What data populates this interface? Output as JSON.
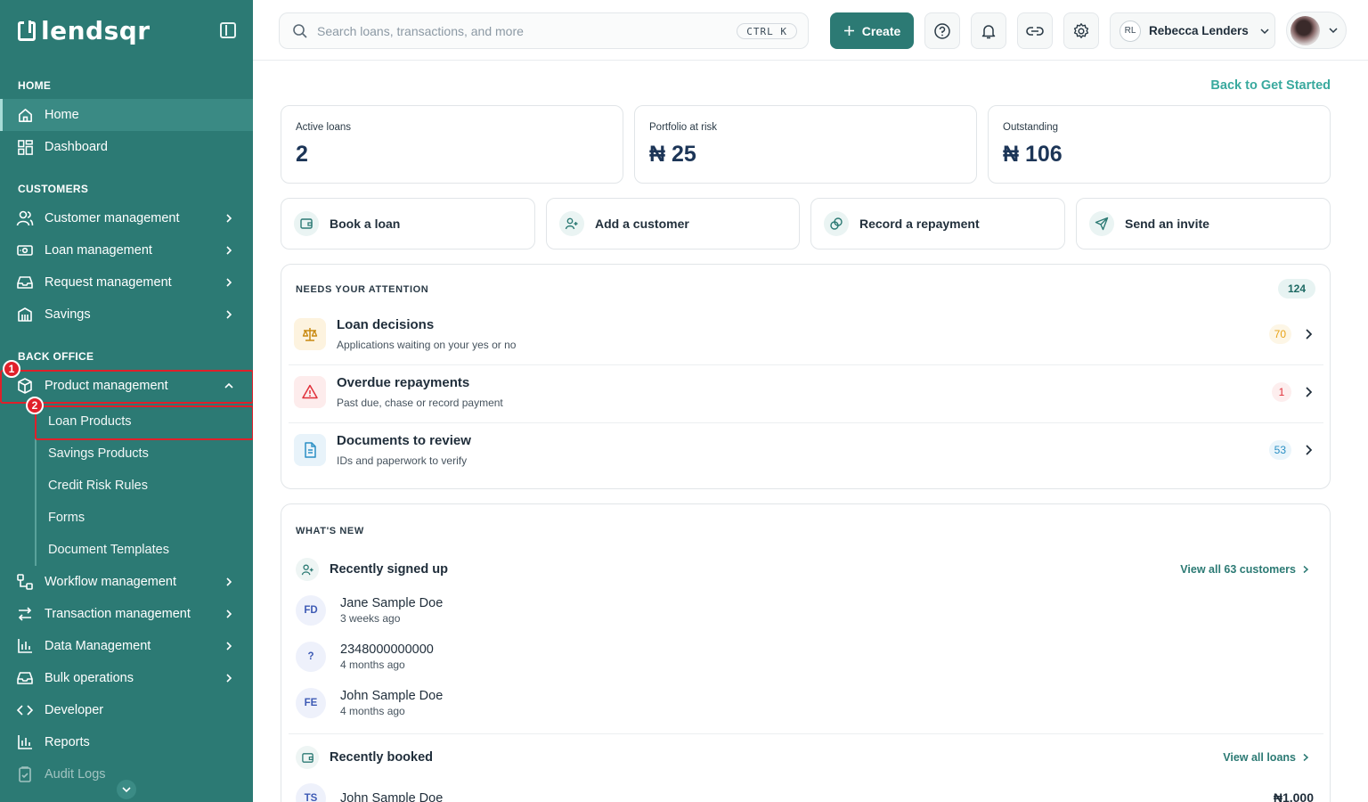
{
  "sidebar": {
    "logo": "lendsqr",
    "sections": {
      "home": "HOME",
      "customers": "CUSTOMERS",
      "back_office": "BACK OFFICE"
    },
    "items": {
      "home": "Home",
      "dashboard": "Dashboard",
      "customer_management": "Customer management",
      "loan_management": "Loan management",
      "request_management": "Request management",
      "savings": "Savings",
      "product_management": "Product management",
      "workflow_management": "Workflow management",
      "transaction_management": "Transaction management",
      "data_management": "Data Management",
      "bulk_operations": "Bulk operations",
      "developer": "Developer",
      "reports": "Reports",
      "audit_logs": "Audit Logs"
    },
    "sub_items": {
      "loan_products": "Loan Products",
      "savings_products": "Savings Products",
      "credit_risk_rules": "Credit Risk Rules",
      "forms": "Forms",
      "document_templates": "Document Templates"
    },
    "markers": {
      "one": "1",
      "two": "2"
    }
  },
  "topbar": {
    "search_placeholder": "Search loans, transactions, and more",
    "shortcut": "CTRL K",
    "create_label": "Create",
    "user_initials": "RL",
    "user_name": "Rebecca Lenders"
  },
  "main": {
    "back_link": "Back to Get Started",
    "stats": [
      {
        "label": "Active loans",
        "value": "2"
      },
      {
        "label": "Portfolio at risk",
        "value": "₦ 25"
      },
      {
        "label": "Outstanding",
        "value": "₦ 106"
      }
    ],
    "actions": [
      "Book a loan",
      "Add a customer",
      "Record a repayment",
      "Send an invite"
    ],
    "attention": {
      "title": "NEEDS YOUR ATTENTION",
      "total": "124",
      "rows": [
        {
          "title": "Loan decisions",
          "subtitle": "Applications waiting on your yes or no",
          "count": "70"
        },
        {
          "title": "Overdue repayments",
          "subtitle": "Past due, chase or record payment",
          "count": "1"
        },
        {
          "title": "Documents to review",
          "subtitle": "IDs and paperwork to verify",
          "count": "53"
        }
      ]
    },
    "whats_new": {
      "title": "WHAT'S NEW",
      "signed_up": {
        "title": "Recently signed up",
        "link": "View all 63 customers",
        "people": [
          {
            "initials": "FD",
            "name": "Jane Sample Doe",
            "time": "3 weeks ago"
          },
          {
            "initials": "?",
            "name": "2348000000000",
            "time": "4 months ago"
          },
          {
            "initials": "FE",
            "name": "John Sample Doe",
            "time": "4 months ago"
          }
        ]
      },
      "booked": {
        "title": "Recently booked",
        "link": "View all loans",
        "people": [
          {
            "initials": "TS",
            "name": "John Sample Doe",
            "amount": "₦1,000"
          }
        ]
      }
    }
  },
  "colors": {
    "brand": "#2c7a74",
    "accent": "#39a99e",
    "highlight": "#e0202a",
    "warn": "#e8a317",
    "danger": "#e0303a"
  }
}
